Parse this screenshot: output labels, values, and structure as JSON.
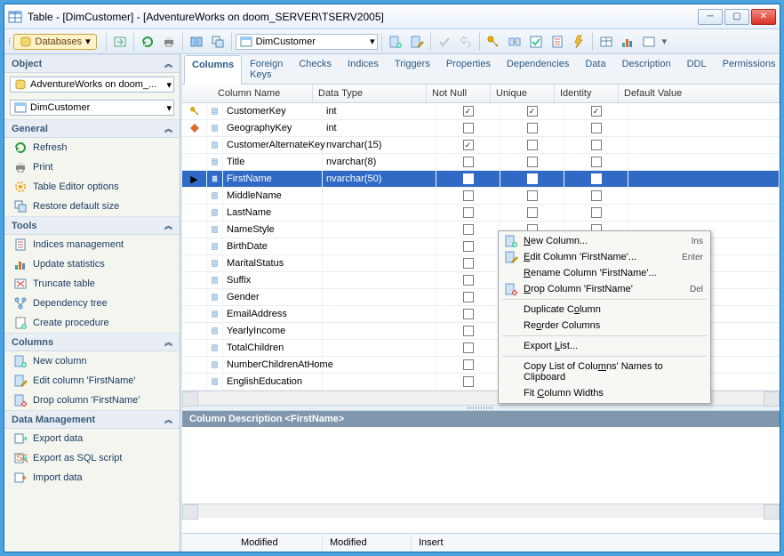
{
  "window": {
    "title": "Table - [DimCustomer] - [AdventureWorks on doom_SERVER\\TSERV2005]"
  },
  "toolbar": {
    "databases_label": "Databases",
    "table_combo": "DimCustomer"
  },
  "sidebar": {
    "object_heading": "Object",
    "db_combo": "AdventureWorks on doom_...",
    "table_combo": "DimCustomer",
    "sections": {
      "general": {
        "title": "General",
        "items": [
          "Refresh",
          "Print",
          "Table Editor options",
          "Restore default size"
        ]
      },
      "tools": {
        "title": "Tools",
        "items": [
          "Indices management",
          "Update statistics",
          "Truncate table",
          "Dependency tree",
          "Create procedure"
        ]
      },
      "columns": {
        "title": "Columns",
        "items": [
          "New column",
          "Edit column 'FirstName'",
          "Drop column 'FirstName'"
        ]
      },
      "data": {
        "title": "Data Management",
        "items": [
          "Export data",
          "Export as SQL script",
          "Import data"
        ]
      }
    }
  },
  "tabs": [
    "Columns",
    "Foreign Keys",
    "Checks",
    "Indices",
    "Triggers",
    "Properties",
    "Dependencies",
    "Data",
    "Description",
    "DDL",
    "Permissions"
  ],
  "active_tab": 0,
  "grid": {
    "headers": {
      "name": "Column Name",
      "dtype": "Data Type",
      "notnull": "Not Null",
      "unique": "Unique",
      "identity": "Identity",
      "default": "Default Value"
    },
    "rows": [
      {
        "pk": true,
        "name": "CustomerKey",
        "dtype": "int",
        "nn": true,
        "uq": true,
        "id": true
      },
      {
        "pk": false,
        "diamond": true,
        "name": "GeographyKey",
        "dtype": "int",
        "nn": false,
        "uq": false,
        "id": false
      },
      {
        "pk": false,
        "name": "CustomerAlternateKey",
        "dtype": "nvarchar(15)",
        "nn": true,
        "uq": false,
        "id": false
      },
      {
        "pk": false,
        "name": "Title",
        "dtype": "nvarchar(8)",
        "nn": false,
        "uq": false,
        "id": false
      },
      {
        "pk": false,
        "name": "FirstName",
        "dtype": "nvarchar(50)",
        "nn": false,
        "uq": false,
        "id": false,
        "selected": true
      },
      {
        "pk": false,
        "name": "MiddleName",
        "dtype": "",
        "nn": false,
        "uq": false,
        "id": false
      },
      {
        "pk": false,
        "name": "LastName",
        "dtype": "",
        "nn": false,
        "uq": false,
        "id": false
      },
      {
        "pk": false,
        "name": "NameStyle",
        "dtype": "",
        "nn": false,
        "uq": false,
        "id": false
      },
      {
        "pk": false,
        "name": "BirthDate",
        "dtype": "",
        "nn": false,
        "uq": false,
        "id": false
      },
      {
        "pk": false,
        "name": "MaritalStatus",
        "dtype": "",
        "nn": false,
        "uq": false,
        "id": false
      },
      {
        "pk": false,
        "name": "Suffix",
        "dtype": "",
        "nn": false,
        "uq": false,
        "id": false
      },
      {
        "pk": false,
        "name": "Gender",
        "dtype": "",
        "nn": false,
        "uq": false,
        "id": false
      },
      {
        "pk": false,
        "name": "EmailAddress",
        "dtype": "",
        "nn": false,
        "uq": false,
        "id": false
      },
      {
        "pk": false,
        "name": "YearlyIncome",
        "dtype": "",
        "nn": false,
        "uq": false,
        "id": false
      },
      {
        "pk": false,
        "name": "TotalChildren",
        "dtype": "",
        "nn": false,
        "uq": false,
        "id": false
      },
      {
        "pk": false,
        "name": "NumberChildrenAtHome",
        "dtype": "",
        "nn": false,
        "uq": false,
        "id": false
      },
      {
        "pk": false,
        "name": "EnglishEducation",
        "dtype": "",
        "nn": false,
        "uq": false,
        "id": false
      }
    ]
  },
  "context_menu": [
    {
      "label_html": "<u>N</u>ew Column...",
      "shortcut": "Ins",
      "icon": "new-col"
    },
    {
      "label_html": "<u>E</u>dit Column 'FirstName'...",
      "shortcut": "Enter",
      "icon": "edit-col"
    },
    {
      "label_html": "<u>R</u>ename Column 'FirstName'..."
    },
    {
      "label_html": "<u>D</u>rop Column 'FirstName'",
      "shortcut": "Del",
      "icon": "drop-col"
    },
    {
      "sep": true
    },
    {
      "label_html": "Duplicate C<u>o</u>lumn"
    },
    {
      "label_html": "Re<u>o</u>rder Columns"
    },
    {
      "sep": true
    },
    {
      "label_html": "Export <u>L</u>ist..."
    },
    {
      "sep": true
    },
    {
      "label_html": "Copy List of Colu<u>m</u>ns' Names to Clipboard"
    },
    {
      "label_html": "Fit <u>C</u>olumn Widths"
    }
  ],
  "description_heading": "Column Description <FirstName>",
  "statusbar": {
    "c1": "Modified",
    "c2": "Modified",
    "c3": "Insert"
  }
}
